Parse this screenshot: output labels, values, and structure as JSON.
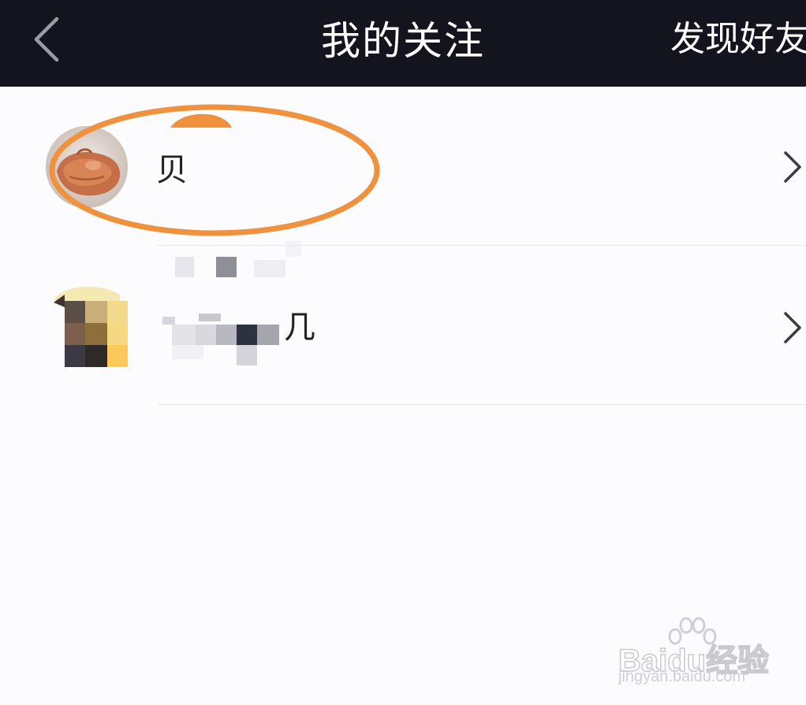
{
  "header": {
    "title": "我的关注",
    "action_label": "发现好友",
    "back_icon": "chevron-left-icon",
    "background": "#13141e"
  },
  "follows": [
    {
      "name_visible_fragment": "贝",
      "name_obscured": true,
      "avatar": "hand-photo-avatar",
      "chevron_icon": "chevron-right-icon",
      "highlighted": true
    },
    {
      "name_visible_fragment": "几",
      "name_obscured": true,
      "avatar": "mosaic-avatar",
      "chevron_icon": "chevron-right-icon",
      "highlighted": false
    }
  ],
  "highlight_color": "#f0913e",
  "watermark": {
    "logo_text": "Baidu经验",
    "url_text": "jingyan.baidu.com"
  }
}
